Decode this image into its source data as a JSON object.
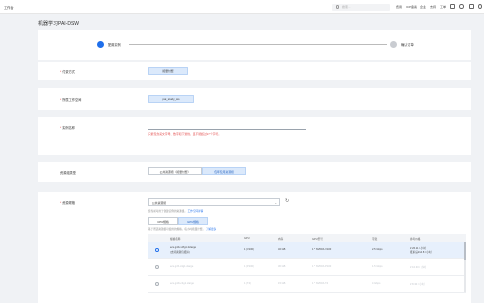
{
  "topbar": {
    "workspace": "工作台",
    "search_placeholder": "搜索...",
    "nav": [
      "费用",
      "ICP备案",
      "企业",
      "支持",
      "工单"
    ]
  },
  "page_title": "机器学习PAI-DSW",
  "steps": [
    {
      "label": "配置实例",
      "status": "active"
    },
    {
      "label": "确认订单",
      "status": "pending"
    }
  ],
  "form": {
    "billing": {
      "label": "付费方式",
      "value": "按量付费"
    },
    "workspace": {
      "label": "所属工作空间",
      "value": "pai_study_ws"
    },
    "instance_name": {
      "label": "实例名称",
      "value": "",
      "error": "只能包含英文字母、数字和下划线，且不能超过27个字符。"
    },
    "resource_type": {
      "label": "资源组类型",
      "options": [
        "公共资源组（按量付费）",
        "包年包月资源组"
      ],
      "selected": 1
    },
    "resource_spec": {
      "label": "资源规格",
      "select_value": "公共资源组",
      "hint": "您当前可用于创建实例的资源组。",
      "hint_link": "工作空间详情",
      "type_tabs": [
        "CPU规格",
        "GPU规格"
      ],
      "type_selected": 1,
      "hint2": "基于所选资源组可使用的规格，每小时按量计费。",
      "hint2_link": "了解更多",
      "columns": [
        "规格名称",
        "GPU",
        "内存",
        "GPU型号",
        "带宽",
        "参考价格"
      ],
      "rows": [
        {
          "name": "ecs.gn6v-c8g1.2xlarge",
          "sub": "(支持资源包抵扣)",
          "gpu": "1 (V100)",
          "mem": "32 GB",
          "model": "1 * NVIDIA V100",
          "bw": "2.5 Gbps",
          "price": "¥ 26.11 / 小时",
          "price_sub": "抵扣后¥14.8 / 小时",
          "selected": true,
          "disabled": false
        },
        {
          "name": "ecs.gn5-c4g1.xlarge",
          "sub": "",
          "gpu": "1 (P100)",
          "mem": "30 GB",
          "model": "1 * NVIDIA P100",
          "bw": "1.5 Gbps",
          "price": "¥ 10.30 / 小时",
          "price_sub": "",
          "selected": false,
          "disabled": true
        },
        {
          "name": "ecs.gn6i-c4g1.xlarge",
          "sub": "",
          "gpu": "1 (T4)",
          "mem": "15 GB",
          "model": "1 * NVIDIA T4",
          "bw": "4 Gbps",
          "price": "¥ 8.30 / 小时",
          "price_sub": "",
          "selected": false,
          "disabled": true
        }
      ]
    }
  }
}
